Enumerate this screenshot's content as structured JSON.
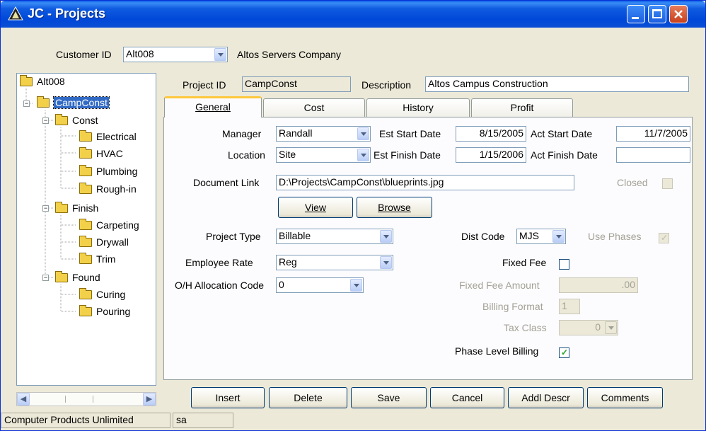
{
  "window": {
    "title": "JC - Projects",
    "app_icon": "app-triangle-icon"
  },
  "customer": {
    "label": "Customer ID",
    "value": "Alt008",
    "name": "Altos Servers Company"
  },
  "project": {
    "id_label": "Project ID",
    "id_value": "CampConst",
    "desc_label": "Description",
    "desc_value": "Altos Campus Construction"
  },
  "tree": {
    "root": "Alt008",
    "selected": "CampConst",
    "groups": [
      {
        "label": "Const",
        "children": [
          "Electrical",
          "HVAC",
          "Plumbing",
          "Rough-in"
        ]
      },
      {
        "label": "Finish",
        "children": [
          "Carpeting",
          "Drywall",
          "Trim"
        ]
      },
      {
        "label": "Found",
        "children": [
          "Curing",
          "Pouring"
        ]
      }
    ]
  },
  "tabs": [
    "General",
    "Cost",
    "History",
    "Profit"
  ],
  "general": {
    "manager_label": "Manager",
    "manager_value": "Randall",
    "location_label": "Location",
    "location_value": "Site",
    "est_start_label": "Est Start Date",
    "est_start_value": "8/15/2005",
    "est_finish_label": "Est Finish Date",
    "est_finish_value": "1/15/2006",
    "act_start_label": "Act Start Date",
    "act_start_value": "11/7/2005",
    "act_finish_label": "Act Finish Date",
    "act_finish_value": "",
    "doclink_label": "Document Link",
    "doclink_value": "D:\\Projects\\CampConst\\blueprints.jpg",
    "closed_label": "Closed",
    "view_label": "View",
    "browse_label": "Browse",
    "project_type_label": "Project Type",
    "project_type_value": "Billable",
    "emp_rate_label": "Employee Rate",
    "emp_rate_value": "Reg",
    "oh_label": "O/H Allocation Code",
    "oh_value": "0",
    "dist_code_label": "Dist Code",
    "dist_code_value": "MJS",
    "use_phases_label": "Use Phases",
    "fixed_fee_label": "Fixed Fee",
    "fixed_fee_amount_label": "Fixed Fee Amount",
    "fixed_fee_amount_value": ".00",
    "billing_format_label": "Billing Format",
    "billing_format_value": "1",
    "tax_class_label": "Tax Class",
    "tax_class_value": "0",
    "phase_billing_label": "Phase Level Billing"
  },
  "checks": {
    "closed": false,
    "use_phases": true,
    "fixed_fee": false,
    "phase_level_billing": true
  },
  "actions": [
    "Insert",
    "Delete",
    "Save",
    "Cancel",
    "Addl Descr",
    "Comments"
  ],
  "status": {
    "company": "Computer Products Unlimited",
    "user": "sa"
  }
}
